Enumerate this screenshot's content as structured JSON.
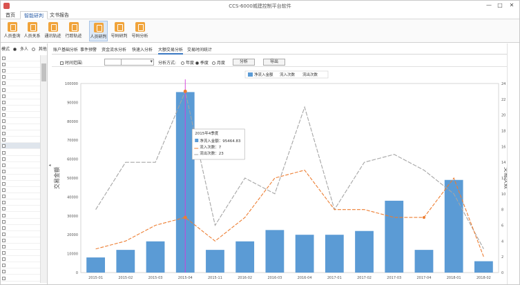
{
  "window": {
    "title": "CCS-6000城建控制平台软件",
    "btn_minimize": "—",
    "btn_restore": "□",
    "btn_close": "✕"
  },
  "menu_tabs": [
    "首页",
    "智能研判",
    "文书报告"
  ],
  "ribbon": {
    "items": [
      "人员查询",
      "人员关系",
      "通讯轨迹",
      "行踪轨迹",
      "人员研判",
      "号码研判",
      "号码分析"
    ],
    "active_index": 4
  },
  "left_panel": {
    "filter_label": "模式",
    "option_multi": "多人",
    "option_other": "其他",
    "row_count": 36,
    "selected_row": 14
  },
  "sub_tabs": [
    "账户基础分析",
    "事件预警",
    "资金流水分析",
    "快速入分析",
    "大额交易分析",
    "交易时间统计"
  ],
  "sub_tab_active_index": 4,
  "filter_bar": {
    "time_range_label": "时间范围:",
    "mode_label": "分析方式:",
    "opt_year": "年度",
    "opt_quarter": "季度",
    "opt_month": "月度",
    "analyze_button": "分析",
    "export_button": "导出"
  },
  "colors": {
    "bar": "#5b9bd5",
    "line_in": "#ed7d31",
    "line_out": "#a5a5a5",
    "hover_line": "#d63ad8"
  },
  "chart_data": {
    "type": "bar",
    "categories": [
      "2015-01",
      "2015-02",
      "2015-03",
      "2015-04",
      "2015-11",
      "2016-02",
      "2016-03",
      "2016-04",
      "2017-01",
      "2017-02",
      "2017-03",
      "2017-04",
      "2018-01",
      "2018-02"
    ],
    "series": [
      {
        "name": "净流入金额",
        "type": "bar",
        "axis": "left",
        "values": [
          8000,
          12000,
          16500,
          95464.83,
          12000,
          16500,
          22500,
          20000,
          20000,
          22000,
          38000,
          12000,
          49000,
          6000
        ]
      },
      {
        "name": "流入次数",
        "type": "line",
        "axis": "right",
        "values": [
          3,
          4,
          6,
          7,
          4,
          7,
          12,
          13,
          8,
          8,
          7,
          7,
          12,
          2
        ]
      },
      {
        "name": "流出次数",
        "type": "line",
        "axis": "right",
        "values": [
          8,
          14,
          14,
          23,
          6,
          12,
          10,
          21,
          8,
          14,
          15,
          13,
          10,
          3
        ]
      }
    ],
    "ylabel": "交易金额",
    "y2label": "交易次数",
    "ylim": [
      0,
      100000
    ],
    "y2lim": [
      0,
      24
    ],
    "yticks": [
      0,
      10000,
      20000,
      30000,
      40000,
      50000,
      60000,
      70000,
      80000,
      90000,
      100000
    ],
    "y2ticks": [
      0,
      2,
      4,
      6,
      8,
      10,
      12,
      14,
      16,
      18,
      20,
      22,
      24
    ],
    "legend_position": "top-center",
    "grid": false,
    "tooltip": {
      "index": 3,
      "title": "2015年4季度",
      "rows": [
        "净流入金额：95464.83",
        "流入次数：7",
        "流出次数：23"
      ]
    }
  }
}
